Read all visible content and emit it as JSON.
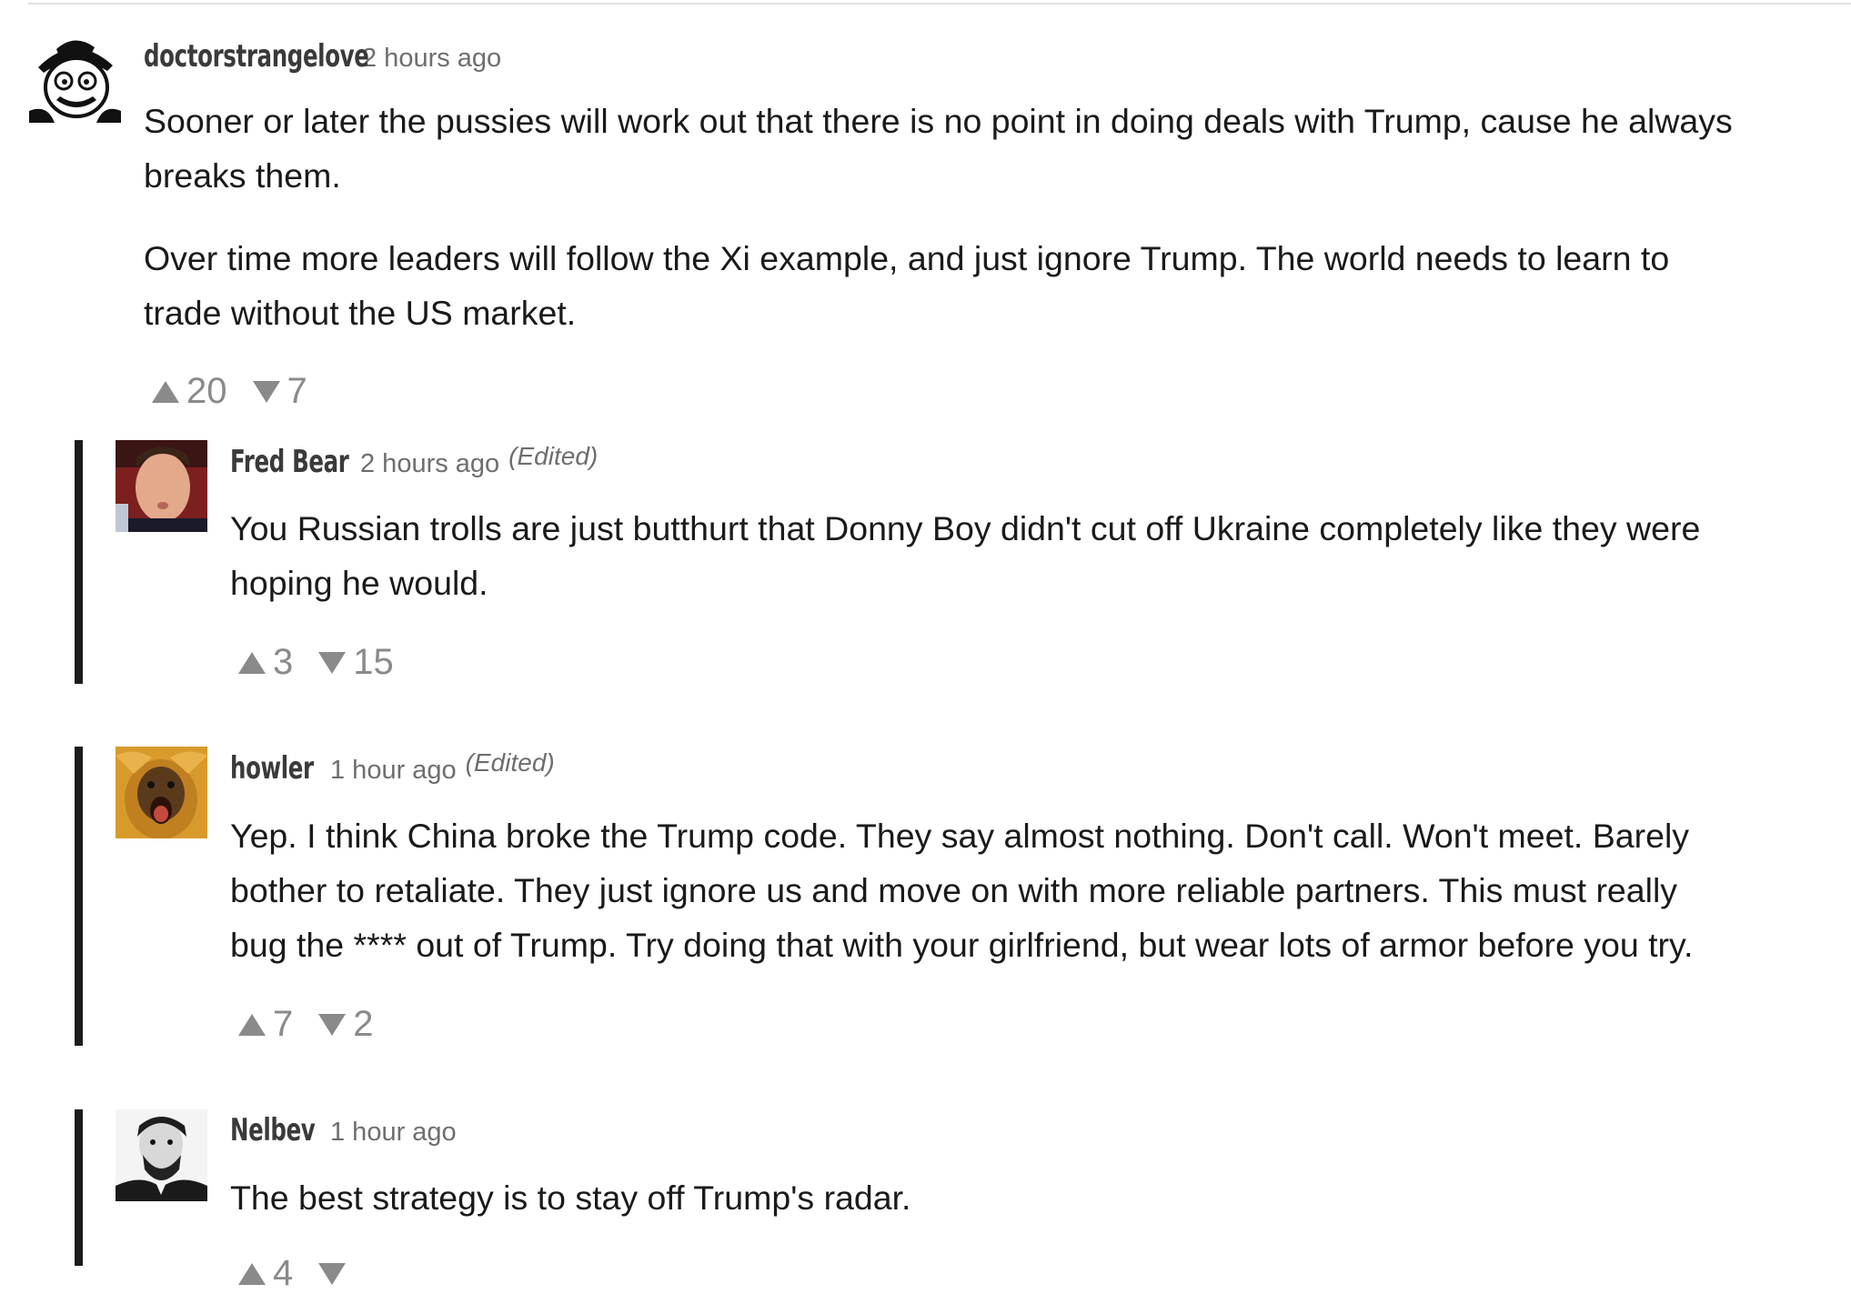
{
  "comments": [
    {
      "author": "doctorstrangelove",
      "time": "2 hours ago",
      "edited": "",
      "paragraphs": [
        "Sooner or later the pussies will work out that there is no point in doing deals with Trump, cause he always",
        "breaks them.",
        "Over time more leaders will follow the Xi example, and just ignore Trump. The world needs to learn to",
        "trade without the US market."
      ],
      "upvotes": "20",
      "downvotes": "7",
      "avatar_icon": "cartoon-spy-avatar"
    },
    {
      "author": "Fred Bear",
      "time": "2 hours ago",
      "edited": "(Edited)",
      "paragraphs": [
        "You Russian trolls are just butthurt that Donny Boy didn't cut off Ukraine completely like they were",
        "hoping he would."
      ],
      "upvotes": "3",
      "downvotes": "15",
      "avatar_icon": "face-photo-avatar"
    },
    {
      "author": "howler",
      "time": "1 hour ago",
      "edited": "(Edited)",
      "paragraphs": [
        "Yep. I think China broke the Trump code. They say almost nothing. Don't call. Won't meet. Barely",
        "bother to retaliate. They just ignore us and move on with more reliable partners. This must really",
        "bug the **** out of Trump. Try doing that with your girlfriend, but wear lots of armor before you try."
      ],
      "upvotes": "7",
      "downvotes": "2",
      "avatar_icon": "howler-monkey-avatar"
    },
    {
      "author": "Nelbev",
      "time": "1 hour ago",
      "edited": "",
      "paragraphs": [
        "The best strategy is to stay off Trump's radar."
      ],
      "upvotes": "4",
      "downvotes": "",
      "avatar_icon": "bearded-man-avatar"
    }
  ],
  "colors": {
    "text": "#1a1a1a",
    "meta": "#6e6e6e",
    "vote": "#8a8a8a",
    "thread_bar": "#1c1c1c"
  }
}
